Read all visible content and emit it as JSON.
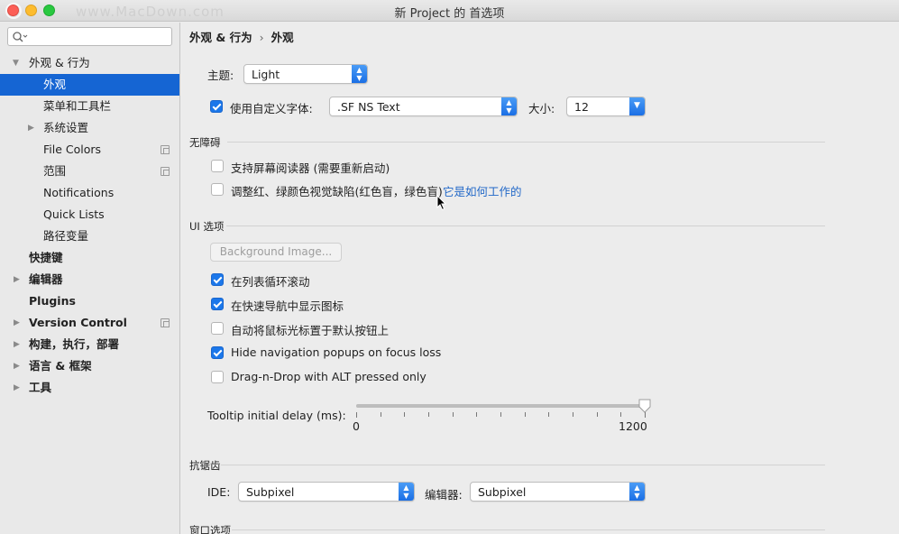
{
  "window": {
    "title": "新 Project 的 首选项",
    "watermark": "www.MacDown.com"
  },
  "sidebar": {
    "search_placeholder": "",
    "items": [
      {
        "label": "外观 & 行为",
        "expanded": true
      },
      {
        "label": "外观",
        "selected": true
      },
      {
        "label": "菜单和工具栏"
      },
      {
        "label": "系统设置"
      },
      {
        "label": "File Colors"
      },
      {
        "label": "范围"
      },
      {
        "label": "Notifications"
      },
      {
        "label": "Quick Lists"
      },
      {
        "label": "路径变量"
      },
      {
        "label": "快捷键"
      },
      {
        "label": "编辑器"
      },
      {
        "label": "Plugins"
      },
      {
        "label": "Version Control"
      },
      {
        "label": "构建，执行，部署"
      },
      {
        "label": "语言 & 框架"
      },
      {
        "label": "工具"
      }
    ]
  },
  "breadcrumb": {
    "parent": "外观 & 行为",
    "separator": "›",
    "current": "外观"
  },
  "theme": {
    "label": "主题:",
    "value": "Light"
  },
  "custom_font": {
    "checkbox_label": "使用自定义字体:",
    "checked": true,
    "font_value": ".SF NS Text",
    "size_label": "大小:",
    "size_value": "12"
  },
  "accessibility": {
    "title": "无障碍",
    "screen_reader": {
      "label": "支持屏幕阅读器 (需要重新启动)",
      "checked": false
    },
    "color_adjust": {
      "label": "调整红、绿颜色视觉缺陷(红色盲，绿色盲)",
      "checked": false
    },
    "how_link": "它是如何工作的"
  },
  "ui_options": {
    "title": "UI 选项",
    "background_button": "Background Image...",
    "checkboxes": [
      {
        "label": "在列表循环滚动",
        "checked": true
      },
      {
        "label": "在快速导航中显示图标",
        "checked": true
      },
      {
        "label": "自动将鼠标光标置于默认按钮上",
        "checked": false
      },
      {
        "label": "Hide navigation popups on focus loss",
        "checked": true
      },
      {
        "label": "Drag-n-Drop with ALT pressed only",
        "checked": false
      }
    ],
    "tooltip": {
      "label": "Tooltip initial delay (ms):",
      "min": "0",
      "max": "1200",
      "value": 1200
    }
  },
  "antialiasing": {
    "title": "抗锯齿",
    "ide_label": "IDE:",
    "ide_value": "Subpixel",
    "editor_label": "编辑器:",
    "editor_value": "Subpixel"
  },
  "window_options": {
    "title": "窗口选项"
  },
  "colors": {
    "accent": "#1565d3",
    "link": "#2369c8"
  }
}
